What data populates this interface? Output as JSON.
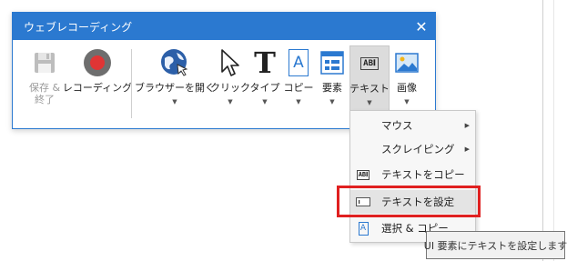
{
  "window": {
    "title": "ウェブレコーディング",
    "close_glyph": "✕"
  },
  "ribbon": {
    "save_label_line1": "保存 &",
    "save_label_line2": "終了",
    "record_label": "レコーディング",
    "open_browser_label": "ブラウザーを開く",
    "click_label": "クリック",
    "type_label": "タイプ",
    "copy_label": "コピー",
    "element_label": "要素",
    "text_label": "テキスト",
    "image_label": "画像",
    "text_icon_glyph": "AB𝐈",
    "type_icon_glyph": "T",
    "copy_icon_glyph": "A"
  },
  "menu": {
    "items": [
      {
        "label": "マウス",
        "has_submenu": true
      },
      {
        "label": "スクレイピング",
        "has_submenu": true
      },
      {
        "label": "テキストをコピー",
        "icon": "text-copy-icon",
        "icon_glyph": "AB𝐈"
      },
      {
        "label": "テキストを設定",
        "icon": "text-set-icon",
        "highlighted": true
      },
      {
        "label": "選択 & コピー",
        "icon": "select-copy-icon",
        "icon_glyph": "A"
      }
    ],
    "submenu_glyph": "▶"
  },
  "tooltip": {
    "text": "UI 要素にテキストを設定します"
  },
  "colors": {
    "title_bar": "#2b79d0",
    "highlight_border": "#e02020",
    "record_dot": "#e03535"
  }
}
